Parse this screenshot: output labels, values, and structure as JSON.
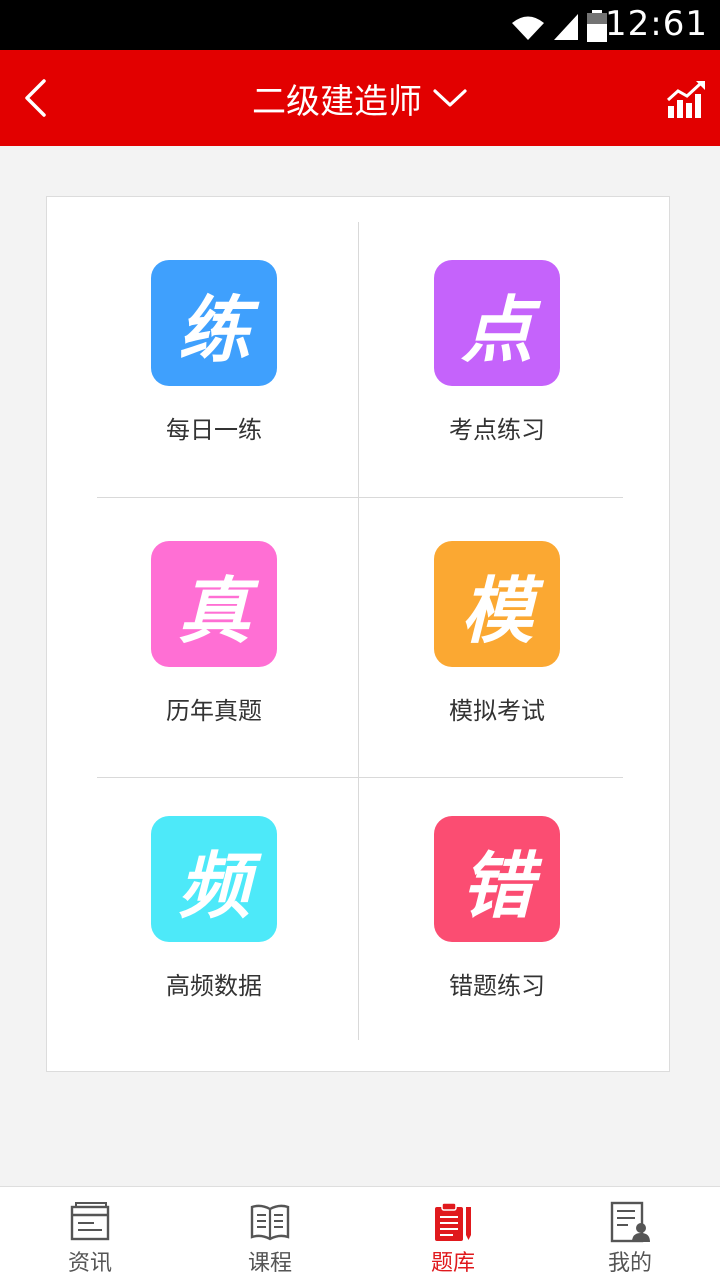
{
  "status_bar": {
    "time": "12:61",
    "icons": [
      "wifi-icon",
      "signal-icon",
      "battery-icon"
    ]
  },
  "header": {
    "title": "二级建造师",
    "back_icon": "chevron-left-icon",
    "dropdown_icon": "chevron-down-icon",
    "stats_icon": "bar-chart-trend-icon",
    "background": "#e20000"
  },
  "grid": {
    "items": [
      {
        "glyph": "练",
        "label": "每日一练",
        "color": "#3fa0fd"
      },
      {
        "glyph": "点",
        "label": "考点练习",
        "color": "#c563fb"
      },
      {
        "glyph": "真",
        "label": "历年真题",
        "color": "#ff6fd4"
      },
      {
        "glyph": "模",
        "label": "模拟考试",
        "color": "#fba832"
      },
      {
        "glyph": "频",
        "label": "高频数据",
        "color": "#4de9f9"
      },
      {
        "glyph": "错",
        "label": "错题练习",
        "color": "#fb4d72"
      }
    ]
  },
  "bottom_nav": {
    "items": [
      {
        "label": "资讯",
        "icon": "news-window-icon",
        "active": false
      },
      {
        "label": "课程",
        "icon": "book-icon",
        "active": false
      },
      {
        "label": "题库",
        "icon": "clipboard-pencil-icon",
        "active": true
      },
      {
        "label": "我的",
        "icon": "profile-document-icon",
        "active": false
      }
    ],
    "active_color": "#e0191d",
    "inactive_color": "#555555"
  }
}
